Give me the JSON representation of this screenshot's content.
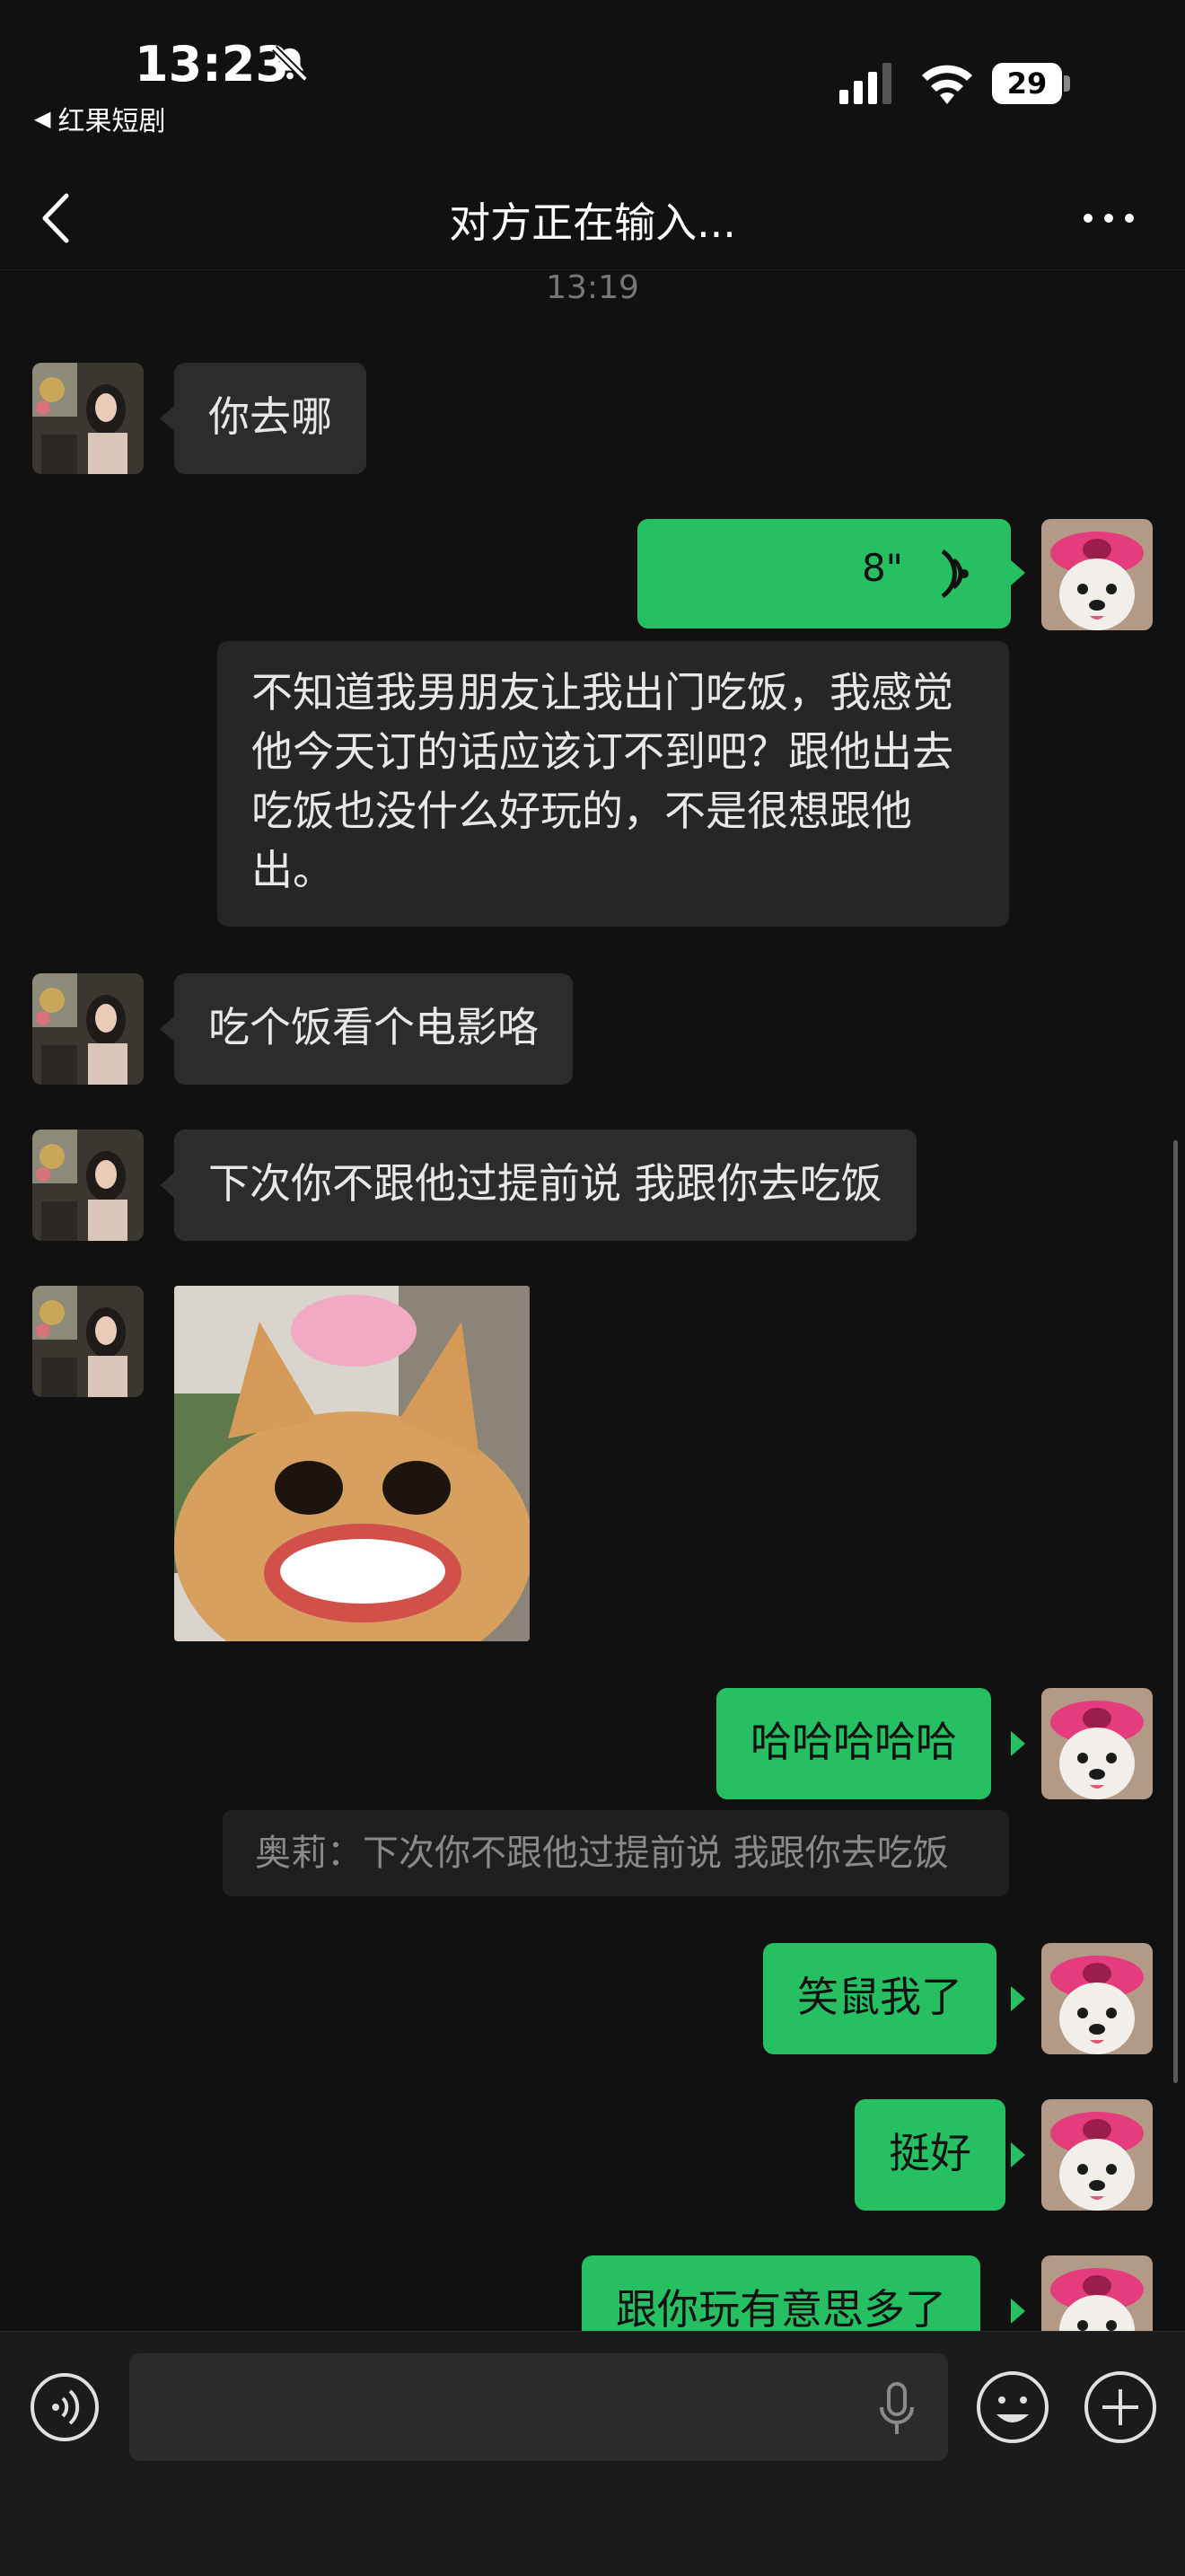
{
  "status": {
    "time": "13:23",
    "back_app": "红果短剧",
    "battery": "29"
  },
  "nav": {
    "title": "对方正在输入..."
  },
  "timestamp": "13:19",
  "messages": {
    "m1": "你去哪",
    "voice_duration": "8\"",
    "transcript": "不知道我男朋友让我出门吃饭，我感觉他今天订的话应该订不到吧？跟他出去吃饭也没什么好玩的，不是很想跟他出。",
    "m3": "吃个饭看个电影咯",
    "m4": "下次你不跟他过提前说 我跟你去吃饭",
    "m5": "哈哈哈哈哈",
    "quote": "奥莉：下次你不跟他过提前说 我跟你去吃饭",
    "m6": "笑鼠我了",
    "m7": "挺好",
    "m8": "跟你玩有意思多了"
  },
  "colors": {
    "outgoing": "#26bf61",
    "incoming": "#2c2c2c",
    "background": "#111111"
  },
  "icons": [
    "mute-bell-icon",
    "signal-icon",
    "wifi-icon",
    "back-chevron-icon",
    "more-icon",
    "voice-wave-icon",
    "mic-icon",
    "emoji-icon",
    "plus-icon"
  ]
}
